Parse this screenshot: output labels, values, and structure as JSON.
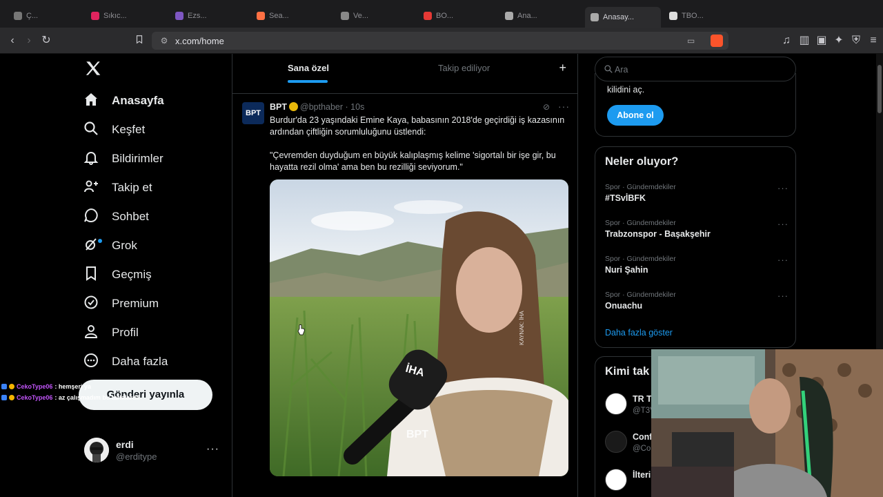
{
  "browser": {
    "tabs": [
      {
        "label": "Ç...",
        "color": "#777"
      },
      {
        "label": "Sıkıc...",
        "color": "#e0245e"
      },
      {
        "label": "Ezs...",
        "color": "#7e57c2"
      },
      {
        "label": "Sea...",
        "color": "#ff7043"
      },
      {
        "label": "Ve...",
        "color": "#888"
      },
      {
        "label": "BO...",
        "color": "#e53935"
      },
      {
        "label": "Ana...",
        "color": "#aaa"
      },
      {
        "label": "Anasay...",
        "color": "#aaa"
      },
      {
        "label": "TBO...",
        "color": "#ddd"
      }
    ],
    "url": "x.com/home"
  },
  "nav": {
    "items": [
      {
        "label": "Anasayfa",
        "icon": "home-icon"
      },
      {
        "label": "Keşfet",
        "icon": "search-icon"
      },
      {
        "label": "Bildirimler",
        "icon": "bell-icon"
      },
      {
        "label": "Takip et",
        "icon": "add-person-icon"
      },
      {
        "label": "Sohbet",
        "icon": "chat-icon"
      },
      {
        "label": "Grok",
        "icon": "grok-icon"
      },
      {
        "label": "Geçmiş",
        "icon": "bookmark-icon"
      },
      {
        "label": "Premium",
        "icon": "verified-icon"
      },
      {
        "label": "Profil",
        "icon": "person-icon"
      },
      {
        "label": "Daha fazla",
        "icon": "more-circle-icon"
      }
    ],
    "post_button": "Gönderi yayınla",
    "user": {
      "name": "erdi",
      "handle": "@erditype"
    }
  },
  "chat_overlay": [
    {
      "user": "CekoType06",
      "message": ": hemşeri ya"
    },
    {
      "user": "CekoType06",
      "message": ": az çalışmadım bu tarlalarda"
    }
  ],
  "feed": {
    "tabs": {
      "for_you": "Sana özel",
      "following": "Takip ediliyor",
      "add": "+"
    },
    "tweet": {
      "avatar_text": "BPT",
      "name": "BPT",
      "handle": "@bpthaber",
      "time": "· 10s",
      "text": "Burdur'da 23 yaşındaki Emine Kaya, babasının 2018'de geçirdiği iş kazasının ardından çiftliğin sorumluluğunu üstlendi:\n\n\"Çevremden duyduğum en büyük kalıplaşmış kelime 'sigortalı bir işe gir, bu hayatta rezil olma' ama ben bu rezilliği seviyorum.\"",
      "media_overlay": [
        "İHA",
        "BPT",
        "KAYNAK: İHA"
      ]
    }
  },
  "right": {
    "search_placeholder": "Ara",
    "premium": {
      "text": "kilidini aç.",
      "button": "Abone ol"
    },
    "trends": {
      "title": "Neler oluyor?",
      "items": [
        {
          "meta": "Spor · Gündemdekiler",
          "title": "#TSvİBFK"
        },
        {
          "meta": "Spor · Gündemdekiler",
          "title": "Trabzonspor - Başakşehir"
        },
        {
          "meta": "Spor · Gündemdekiler",
          "title": "Nuri Şahin"
        },
        {
          "meta": "Spor · Gündemdekiler",
          "title": "Onuachu"
        }
      ],
      "show_more": "Daha fazla göster"
    },
    "who_to_follow": {
      "title": "Kimi tak",
      "items": [
        {
          "name": "TR Tu",
          "handle": "@T3V"
        },
        {
          "name": "Conf",
          "handle": "@Co"
        },
        {
          "name": "İlteri",
          "handle": ""
        }
      ]
    }
  },
  "colors": {
    "accent": "#1d9bf0",
    "background": "#000000",
    "border": "#2f3336",
    "muted": "#71767b"
  }
}
